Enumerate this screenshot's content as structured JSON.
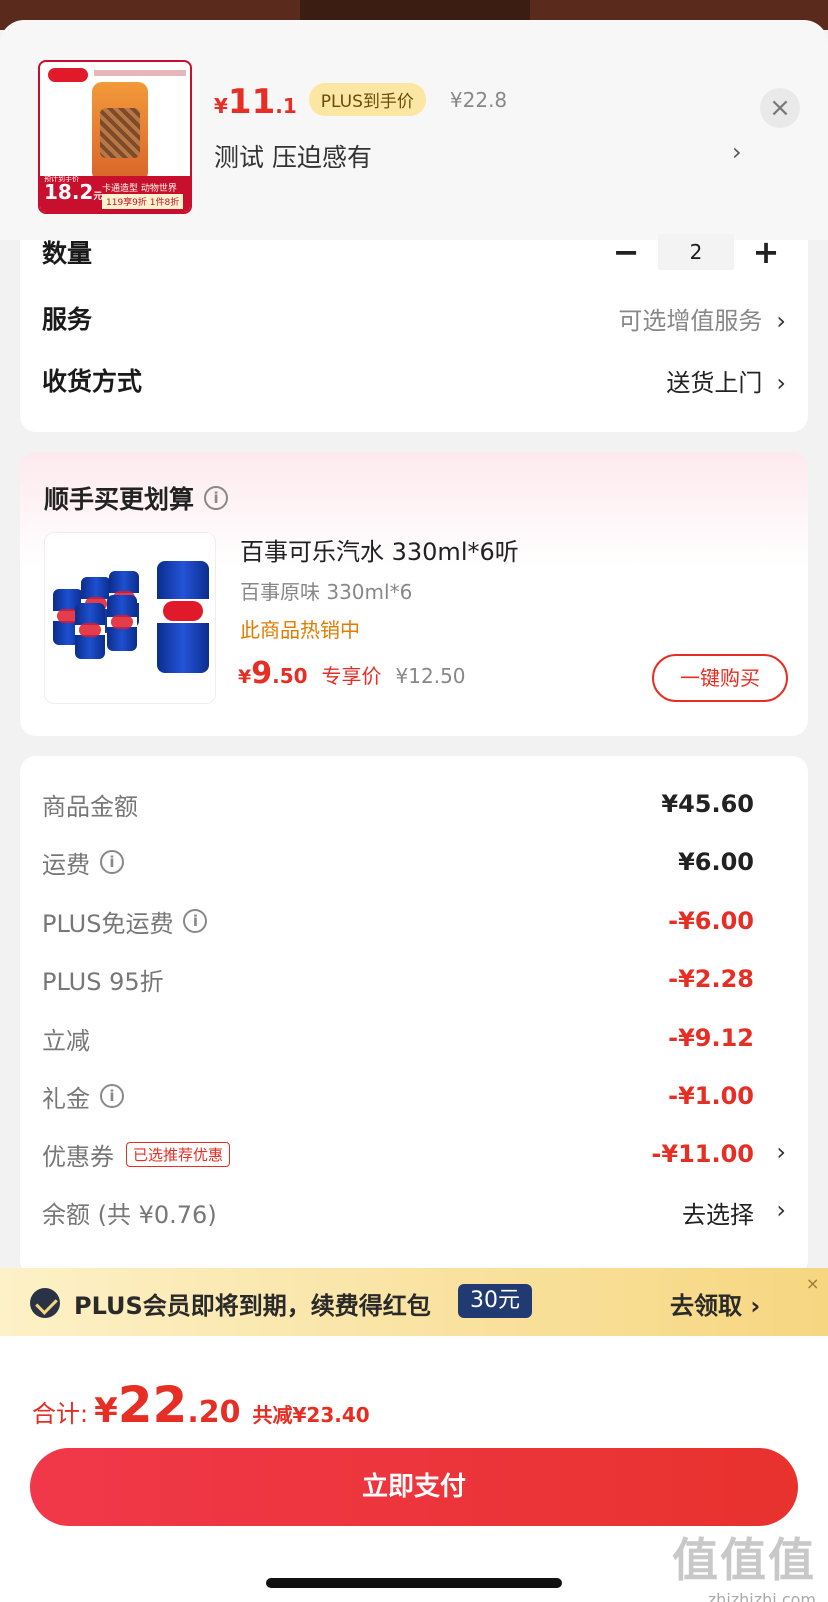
{
  "header": {
    "thumb": {
      "price_int": "18.2",
      "price_unit": "元",
      "banner_text": "卡通造型 动物世界",
      "banner_discount": "119享9折 1件8折",
      "small_label": "预计到手价"
    },
    "price": {
      "currency": "¥",
      "int": "11",
      "dec": ".1"
    },
    "plus_tag": "PLUS到手价",
    "original_price": "¥22.8",
    "variant": "测试  压迫感有",
    "close_glyph": "×",
    "chevron_glyph": "›"
  },
  "spec": {
    "quantity_label": "数量",
    "quantity_value": "2",
    "minus": "−",
    "plus": "+",
    "service_label": "服务",
    "service_value": "可选增值服务",
    "delivery_label": "收货方式",
    "delivery_value": "送货上门",
    "chevron": "›"
  },
  "bundle": {
    "title": "顺手买更划算",
    "info_glyph": "i",
    "product_name": "百事可乐汽水 330ml*6听",
    "product_spec": "百事原味 330ml*6",
    "hot_text": "此商品热销中",
    "price": {
      "currency": "¥",
      "int": "9",
      "dec": ".50"
    },
    "price_tag": "专享价",
    "original_price": "¥12.50",
    "buy_button": "一键购买"
  },
  "summary": {
    "rows": [
      {
        "label": "商品金额",
        "value": "¥45.60"
      },
      {
        "label": "运费",
        "value": "¥6.00"
      },
      {
        "label": "PLUS免运费",
        "value": "-¥6.00"
      },
      {
        "label": "PLUS 95折",
        "value": "-¥2.28"
      },
      {
        "label": "立减",
        "value": "-¥9.12"
      },
      {
        "label": "礼金",
        "value": "-¥1.00"
      },
      {
        "label": "优惠券",
        "value": "-¥11.00",
        "tag": "已选推荐优惠"
      },
      {
        "label": "余额 (共 ¥0.76)",
        "value": "去选择"
      }
    ],
    "chevron": "›",
    "info_glyph": "i"
  },
  "plus_banner": {
    "text": "PLUS会员即将到期，续费得红包",
    "amount": "30元",
    "action": "去领取 ›",
    "close": "×"
  },
  "footer": {
    "total_label": "合计:",
    "currency": "¥",
    "total_int": "22",
    "total_dec": ".20",
    "saved": "共减¥23.40",
    "pay_button": "立即支付",
    "watermark": "值值值",
    "watermark_url": "zhizhizhi.com"
  },
  "colors": {
    "accent_red": "#e62e24",
    "plus_gold": "#fbe7a3",
    "plus_navy": "#223a72",
    "hot_orange": "#e27c00"
  }
}
